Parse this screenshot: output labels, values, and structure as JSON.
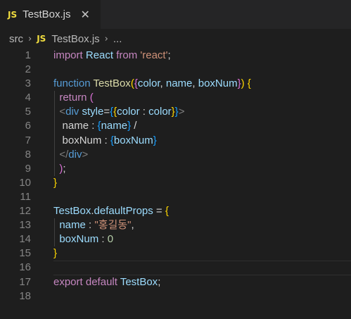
{
  "tab": {
    "badge": "JS",
    "title": "TestBox.js",
    "close": "✕"
  },
  "breadcrumb": {
    "folder": "src",
    "separator1": "›",
    "badge": "JS",
    "file": "TestBox.js",
    "separator2": "›",
    "ellipsis": "..."
  },
  "editor": {
    "line_numbers": [
      "1",
      "2",
      "3",
      "4",
      "5",
      "6",
      "7",
      "8",
      "9",
      "10",
      "11",
      "12",
      "13",
      "14",
      "15",
      "16",
      "17",
      "18"
    ],
    "current_line": 16,
    "lines": [
      [
        {
          "t": "import",
          "c": "t-ctl"
        },
        {
          "t": " ",
          "c": "t-pun"
        },
        {
          "t": "React",
          "c": "t-var"
        },
        {
          "t": " ",
          "c": "t-pun"
        },
        {
          "t": "from",
          "c": "t-ctl"
        },
        {
          "t": " ",
          "c": "t-pun"
        },
        {
          "t": "'react'",
          "c": "t-str"
        },
        {
          "t": ";",
          "c": "t-pun"
        }
      ],
      [],
      [
        {
          "t": "function",
          "c": "t-kw"
        },
        {
          "t": " ",
          "c": "t-pun"
        },
        {
          "t": "TestBox",
          "c": "t-fn"
        },
        {
          "t": "(",
          "c": "t-brk"
        },
        {
          "t": "{",
          "c": "t-br2"
        },
        {
          "t": "color",
          "c": "t-var"
        },
        {
          "t": ", ",
          "c": "t-pun"
        },
        {
          "t": "name",
          "c": "t-var"
        },
        {
          "t": ", ",
          "c": "t-pun"
        },
        {
          "t": "boxNum",
          "c": "t-var"
        },
        {
          "t": "}",
          "c": "t-br2"
        },
        {
          "t": ")",
          "c": "t-brk"
        },
        {
          "t": " ",
          "c": "t-pun"
        },
        {
          "t": "{",
          "c": "t-brk"
        }
      ],
      [
        {
          "t": "  ",
          "c": "t-pun"
        },
        {
          "t": "return",
          "c": "t-ctl"
        },
        {
          "t": " ",
          "c": "t-pun"
        },
        {
          "t": "(",
          "c": "t-br2"
        }
      ],
      [
        {
          "t": "  ",
          "c": "t-pun"
        },
        {
          "t": "<",
          "c": "t-ang"
        },
        {
          "t": "div",
          "c": "t-tag"
        },
        {
          "t": " ",
          "c": "t-pun"
        },
        {
          "t": "style",
          "c": "t-var"
        },
        {
          "t": "=",
          "c": "t-pun"
        },
        {
          "t": "{",
          "c": "t-br3"
        },
        {
          "t": "{",
          "c": "t-brk"
        },
        {
          "t": "color",
          "c": "t-var"
        },
        {
          "t": " : ",
          "c": "t-pun"
        },
        {
          "t": "color",
          "c": "t-var"
        },
        {
          "t": "}",
          "c": "t-brk"
        },
        {
          "t": "}",
          "c": "t-br3"
        },
        {
          "t": ">",
          "c": "t-ang"
        }
      ],
      [
        {
          "t": "   ",
          "c": "t-pun"
        },
        {
          "t": "name : ",
          "c": "t-pun"
        },
        {
          "t": "{",
          "c": "t-br3"
        },
        {
          "t": "name",
          "c": "t-var"
        },
        {
          "t": "}",
          "c": "t-br3"
        },
        {
          "t": " /",
          "c": "t-pun"
        }
      ],
      [
        {
          "t": "   ",
          "c": "t-pun"
        },
        {
          "t": "boxNum : ",
          "c": "t-pun"
        },
        {
          "t": "{",
          "c": "t-br3"
        },
        {
          "t": "boxNum",
          "c": "t-var"
        },
        {
          "t": "}",
          "c": "t-br3"
        }
      ],
      [
        {
          "t": "  ",
          "c": "t-pun"
        },
        {
          "t": "</",
          "c": "t-ang"
        },
        {
          "t": "div",
          "c": "t-tag"
        },
        {
          "t": ">",
          "c": "t-ang"
        }
      ],
      [
        {
          "t": "  ",
          "c": "t-pun"
        },
        {
          "t": ")",
          "c": "t-br2"
        },
        {
          "t": ";",
          "c": "t-pun"
        }
      ],
      [
        {
          "t": "}",
          "c": "t-brk"
        }
      ],
      [],
      [
        {
          "t": "TestBox",
          "c": "t-var"
        },
        {
          "t": ".",
          "c": "t-pun"
        },
        {
          "t": "defaultProps",
          "c": "t-var"
        },
        {
          "t": " = ",
          "c": "t-pun"
        },
        {
          "t": "{",
          "c": "t-brk"
        }
      ],
      [
        {
          "t": "  ",
          "c": "t-pun"
        },
        {
          "t": "name",
          "c": "t-var"
        },
        {
          "t": " : ",
          "c": "t-pun"
        },
        {
          "t": "\"홍길동\"",
          "c": "t-str"
        },
        {
          "t": ",",
          "c": "t-pun"
        }
      ],
      [
        {
          "t": "  ",
          "c": "t-pun"
        },
        {
          "t": "boxNum",
          "c": "t-var"
        },
        {
          "t": " : ",
          "c": "t-pun"
        },
        {
          "t": "0",
          "c": "t-num"
        }
      ],
      [
        {
          "t": "}",
          "c": "t-brk"
        }
      ],
      [],
      [
        {
          "t": "export",
          "c": "t-ctl"
        },
        {
          "t": " ",
          "c": "t-pun"
        },
        {
          "t": "default",
          "c": "t-ctl"
        },
        {
          "t": " ",
          "c": "t-pun"
        },
        {
          "t": "TestBox",
          "c": "t-var"
        },
        {
          "t": ";",
          "c": "t-pun"
        }
      ],
      []
    ]
  }
}
